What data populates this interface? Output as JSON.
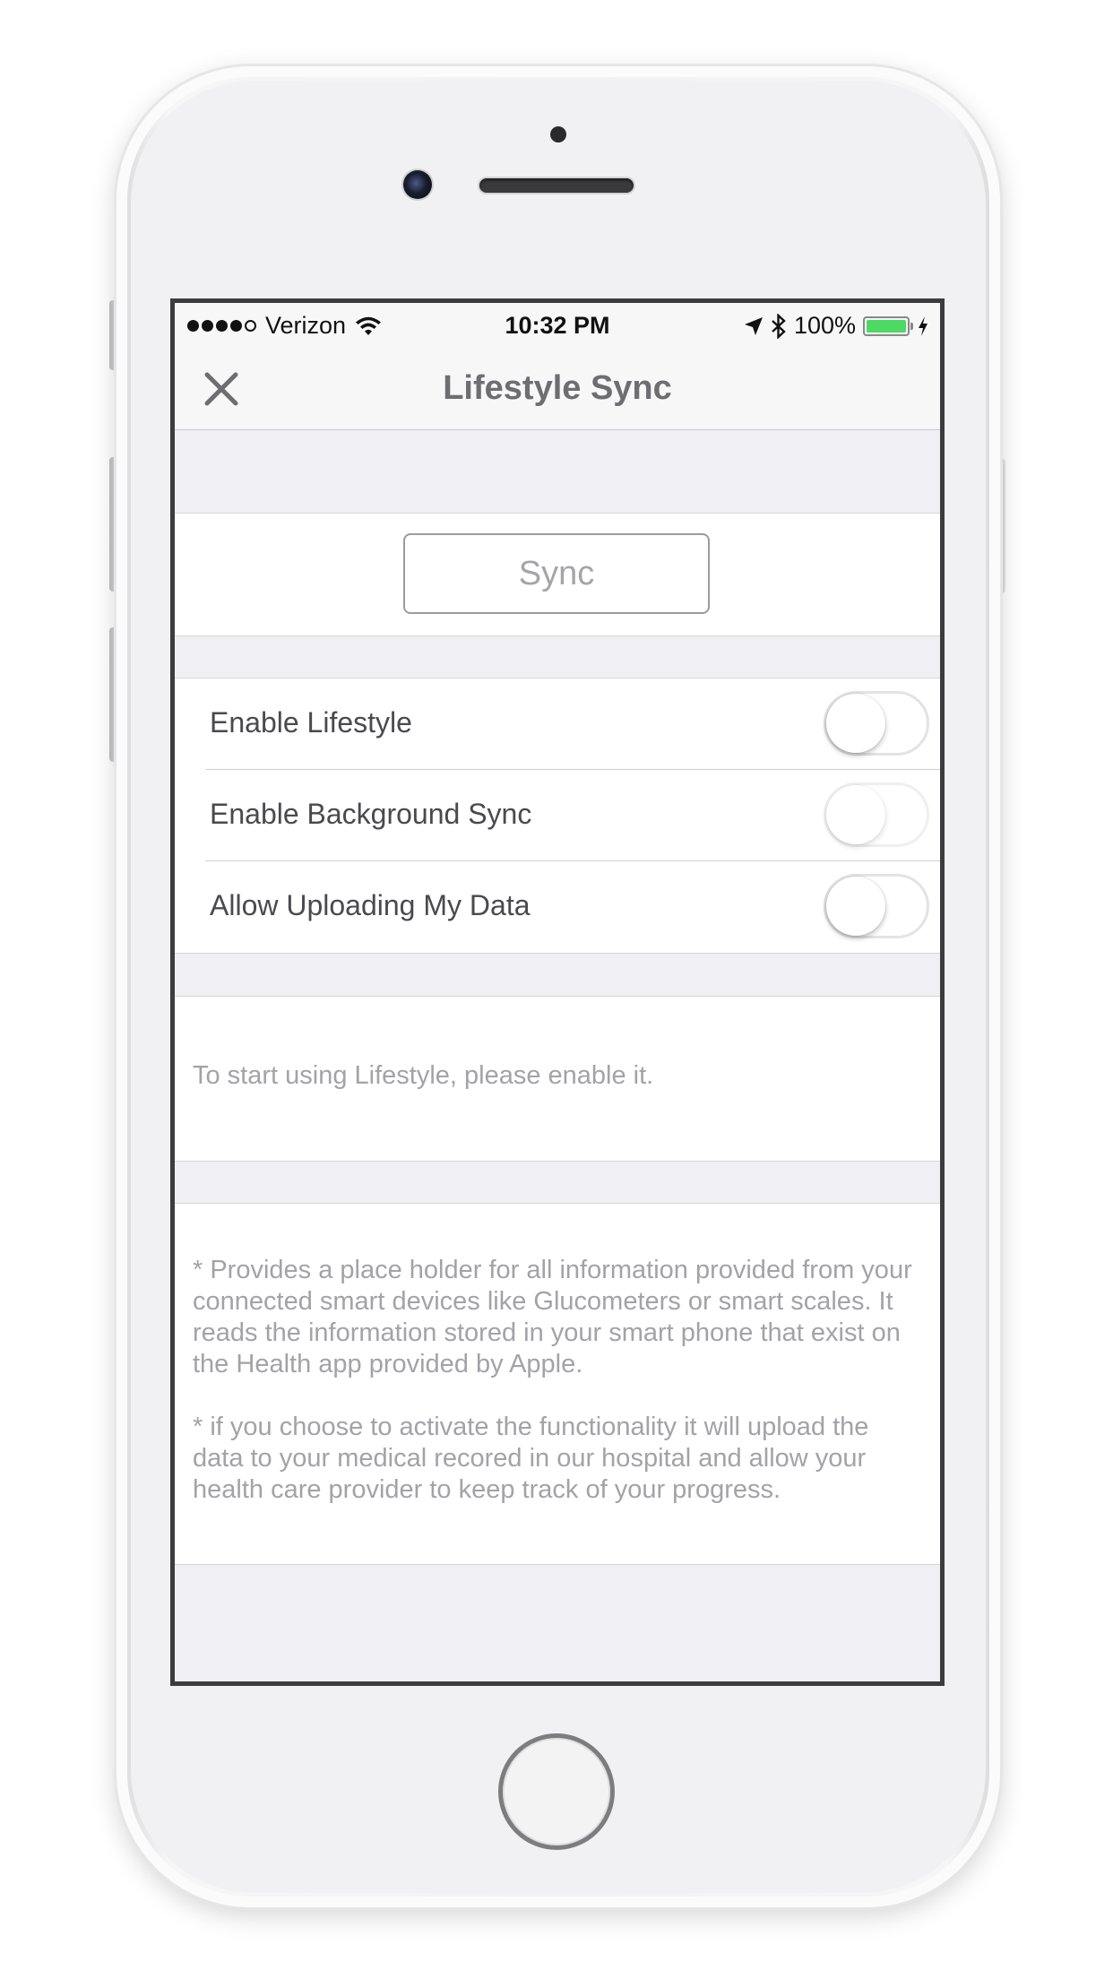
{
  "status_bar": {
    "carrier": "Verizon",
    "time": "10:32 PM",
    "battery": "100%",
    "battery_level": 1.0
  },
  "nav": {
    "title": "Lifestyle Sync",
    "close_icon": "close-icon"
  },
  "sync_button_label": "Sync",
  "toggles": [
    {
      "label": "Enable Lifestyle",
      "on": false
    },
    {
      "label": "Enable Background Sync",
      "on": false
    },
    {
      "label": "Allow Uploading My Data",
      "on": false
    }
  ],
  "info_text": "To start using Lifestyle, please enable it.",
  "notes": [
    "* Provides a place holder for all information provided from your connected smart devices like Glucometers or smart scales. It reads the information stored in your smart phone that exist on the Health app provided by Apple.",
    "* if you choose to activate the functionality it will upload the data to your medical recored in our hospital and allow your health care provider to keep track of your progress."
  ],
  "colors": {
    "background": "#efeff4",
    "accent_battery": "#4cd964",
    "secondary_text": "#a3a3a7"
  }
}
